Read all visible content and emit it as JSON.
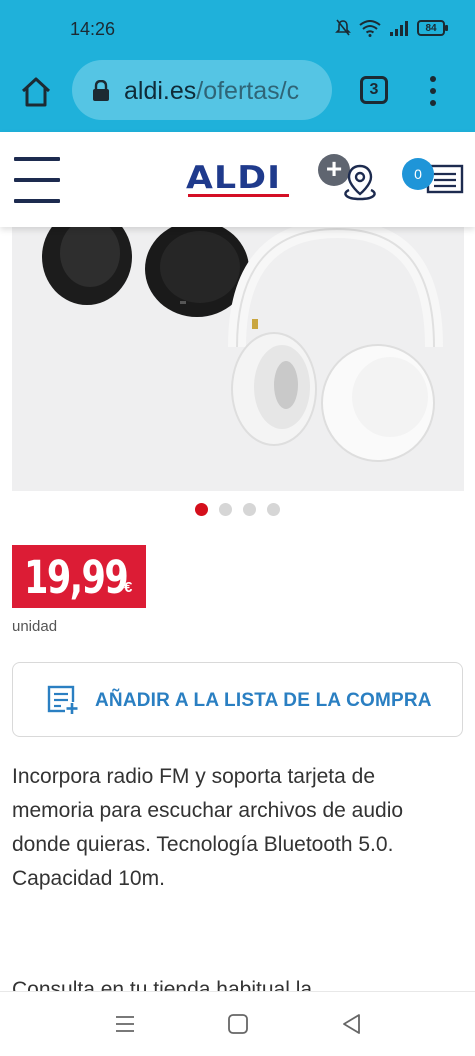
{
  "status_bar": {
    "time": "14:26",
    "battery": "84"
  },
  "browser": {
    "url_domain": "aldi.es",
    "url_path": "/ofertas/c",
    "tab_count": "3"
  },
  "header": {
    "logo_text": "ALDI",
    "cart_count": "0"
  },
  "product": {
    "image_icon": "headphones-image",
    "carousel": {
      "count": 4,
      "active_index": 0
    },
    "price": "19,99",
    "currency": "€",
    "unit": "unidad",
    "add_to_list_label": "AÑADIR A LA LISTA DE LA COMPRA",
    "description": "Incorpora radio FM y soporta tarjeta de memoria para escuchar archivos de audio donde quieras. Tecnología Bluetooth 5.0. Capacidad 10m.",
    "store_note": "Consulta en tu tienda habitual la"
  },
  "colors": {
    "browser_bar": "#1fb1da",
    "aldi_blue": "#1f3a8c",
    "price_red": "#dc1c35",
    "link_blue": "#2a7fc2",
    "cart_badge": "#1f95d8"
  }
}
